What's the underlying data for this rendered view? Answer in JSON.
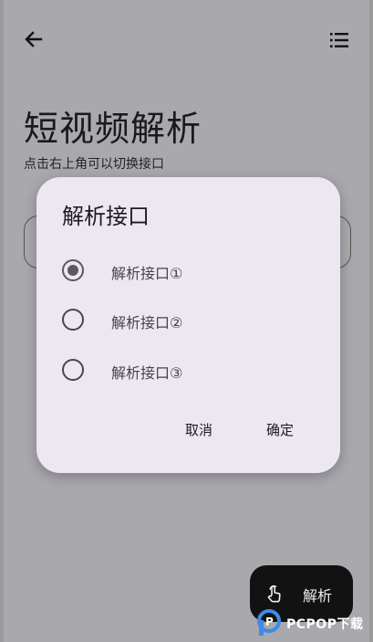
{
  "page": {
    "title": "短视频解析",
    "subtitle": "点击右上角可以切换接口"
  },
  "topbar": {
    "back_icon": "arrow-left-icon",
    "menu_icon": "list-icon"
  },
  "fab": {
    "label": "解析",
    "icon": "touch-hand-icon"
  },
  "watermark": {
    "text": "PCPOP下载",
    "logo_letter": "P"
  },
  "dialog": {
    "title": "解析接口",
    "options": [
      {
        "label": "解析接口①",
        "selected": true
      },
      {
        "label": "解析接口②",
        "selected": false
      },
      {
        "label": "解析接口③",
        "selected": false
      }
    ],
    "cancel_label": "取消",
    "confirm_label": "确定"
  }
}
